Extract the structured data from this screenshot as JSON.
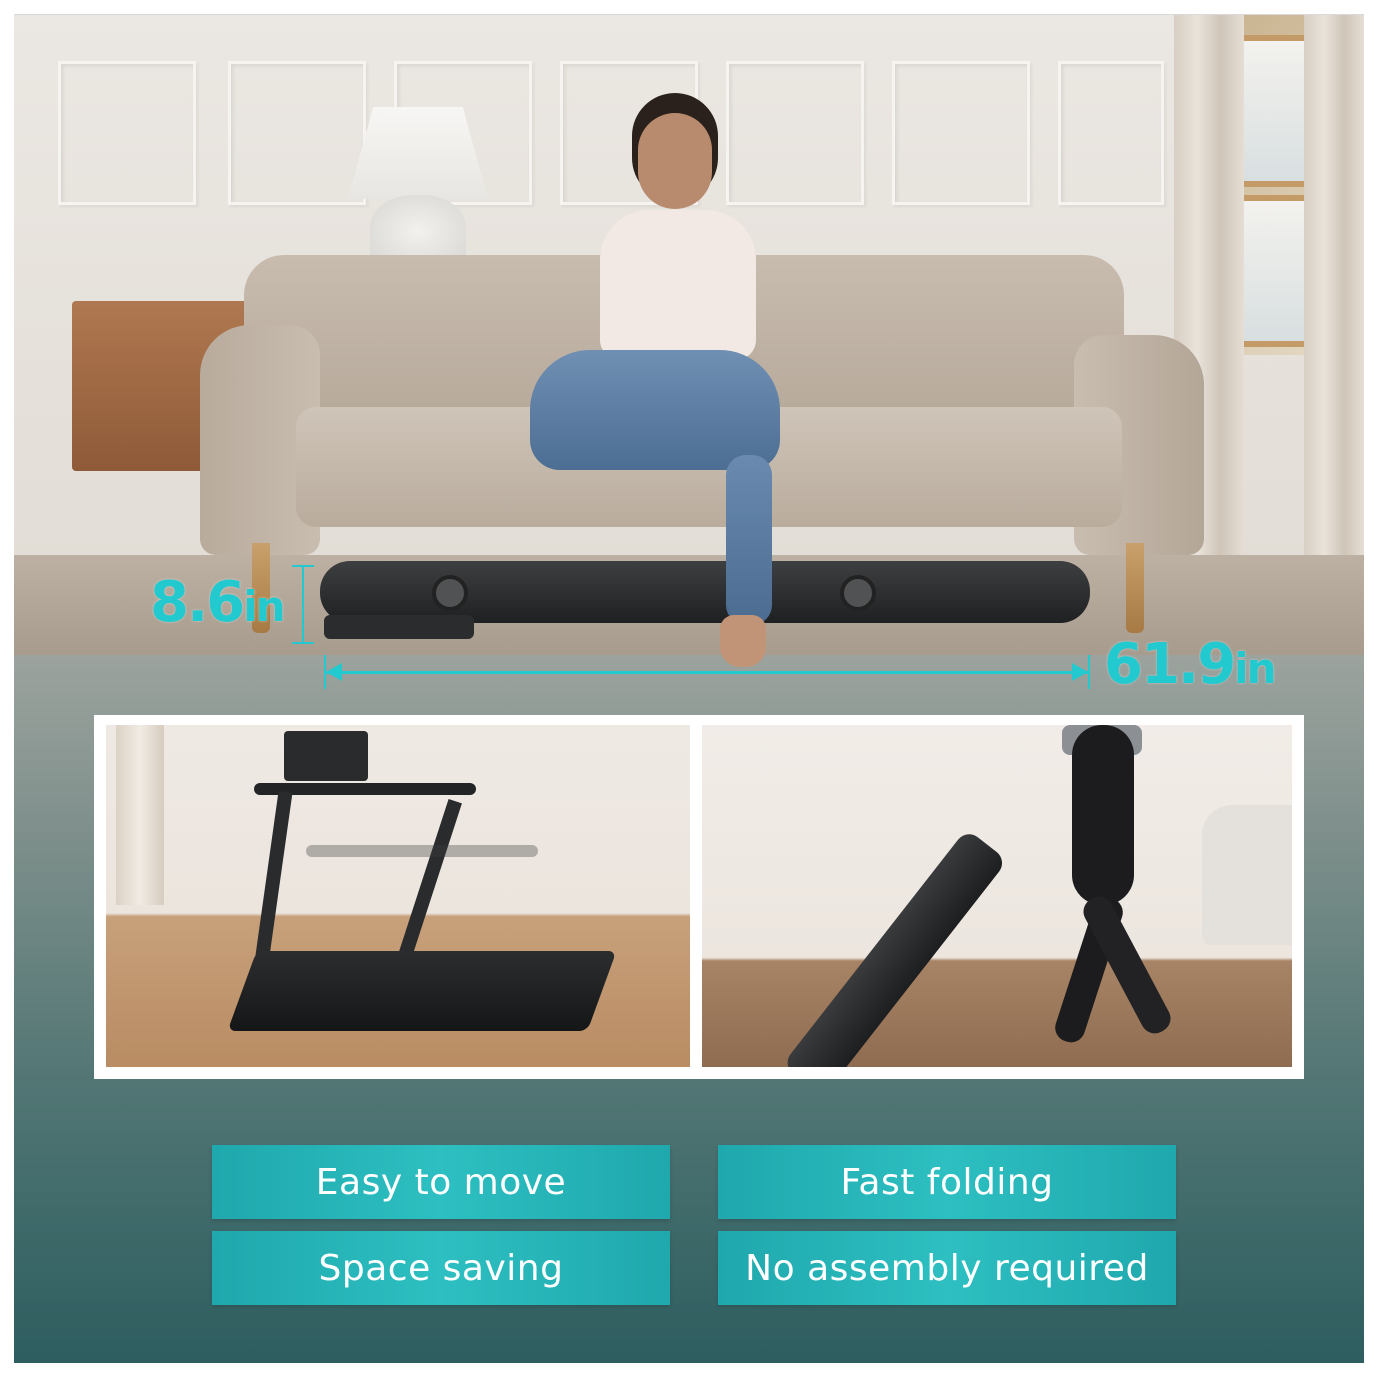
{
  "dimensions": {
    "height_value": "8.6",
    "height_unit": "in",
    "length_value": "61.9",
    "length_unit": "in",
    "accent_color": "#22c9cf"
  },
  "features": {
    "easy_to_move": "Easy to move",
    "fast_folding": "Fast folding",
    "space_saving": "Space saving",
    "no_assembly": "No assembly required",
    "badge_color": "#2bb8bb"
  },
  "scene": {
    "main_photo": "treadmill-under-sofa",
    "inset_left": "treadmill-folding-handrails",
    "inset_right": "woman-rolling-folded-treadmill"
  }
}
